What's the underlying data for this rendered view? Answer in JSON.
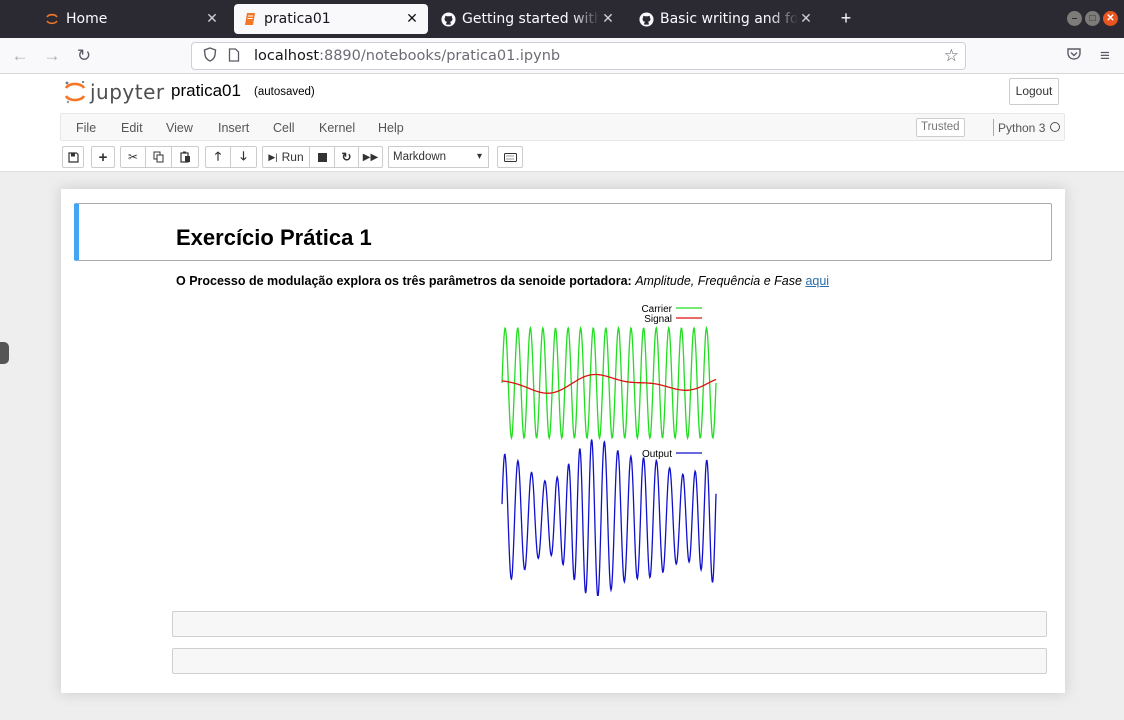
{
  "browser": {
    "tabs": [
      {
        "label": "Home",
        "icon": "jupyter-icon",
        "active": false
      },
      {
        "label": "pratica01",
        "icon": "notebook-icon",
        "active": true
      },
      {
        "label": "Getting started with writ",
        "icon": "github-icon",
        "active": false
      },
      {
        "label": "Basic writing and formatt",
        "icon": "github-icon",
        "active": false
      }
    ],
    "new_tab": "+",
    "url_host": "localhost",
    "url_rest": ":8890/notebooks/pratica01.ipynb"
  },
  "jupyter": {
    "logo_text": "jupyter",
    "notebook_name": "pratica01",
    "save_status": "(autosaved)",
    "logout_label": "Logout",
    "menu": [
      "File",
      "Edit",
      "View",
      "Insert",
      "Cell",
      "Kernel",
      "Help"
    ],
    "trusted_label": "Trusted",
    "kernel_name": "Python 3",
    "toolbar": {
      "run_label": "Run",
      "cell_type": "Markdown"
    }
  },
  "notebook": {
    "heading": "Exercício Prática 1",
    "paragraph_bold": "O Processo de modulação explora os três parâmetros da senoide portadora:",
    "paragraph_italic": "Amplitude, Frequência e Fase",
    "paragraph_link": "aqui",
    "image": {
      "legend_carrier": "Carrier",
      "legend_signal": "Signal",
      "legend_output": "Output",
      "colors": {
        "carrier": "#22dd22",
        "signal": "#dd1111",
        "output": "#1111cc"
      }
    }
  },
  "colors": {
    "selected_cell_border": "#42a5f5",
    "link": "#296eaa",
    "tabstrip": "#2b2a33"
  }
}
